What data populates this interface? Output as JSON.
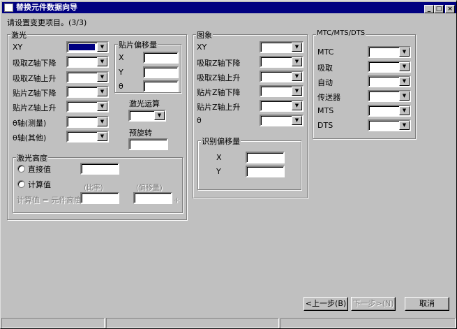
{
  "window": {
    "title": "替换元件数据向导",
    "min": "_",
    "max": "□",
    "close": "×"
  },
  "instruction": "请设置变更项目。(3/3)",
  "laser": {
    "title": "激光",
    "rows": [
      "XY",
      "吸取Z轴下降",
      "吸取Z轴上升",
      "贴片Z轴下降",
      "贴片Z轴上升",
      "θ轴(测量)",
      "θ轴(其他)"
    ],
    "offset": {
      "title": "贴片偏移量",
      "labels": [
        "X",
        "Y",
        "θ"
      ]
    },
    "calc_label": "激光运算",
    "prerotate_label": "预旋转",
    "height": {
      "title": "激光高度",
      "direct": "直接值",
      "calc": "计算值",
      "ratio": "(比率)",
      "offset": "(偏移量)",
      "formula": "计算值 = 元件高度",
      "plus": "+"
    }
  },
  "image": {
    "title": "图象",
    "rows": [
      "XY",
      "吸取Z轴下降",
      "吸取Z轴上升",
      "贴片Z轴下降",
      "贴片Z轴上升",
      "θ"
    ],
    "recog": {
      "title": "识别偏移量",
      "labels": [
        "X",
        "Y"
      ]
    }
  },
  "mtc": {
    "title": "MTC/MTS/DTS",
    "rows": [
      "MTC",
      "吸取",
      "自动",
      "传送器",
      "MTS",
      "DTS"
    ]
  },
  "buttons": {
    "back": "<上一步(B)",
    "next": "下一步>(N)",
    "cancel": "取消"
  }
}
